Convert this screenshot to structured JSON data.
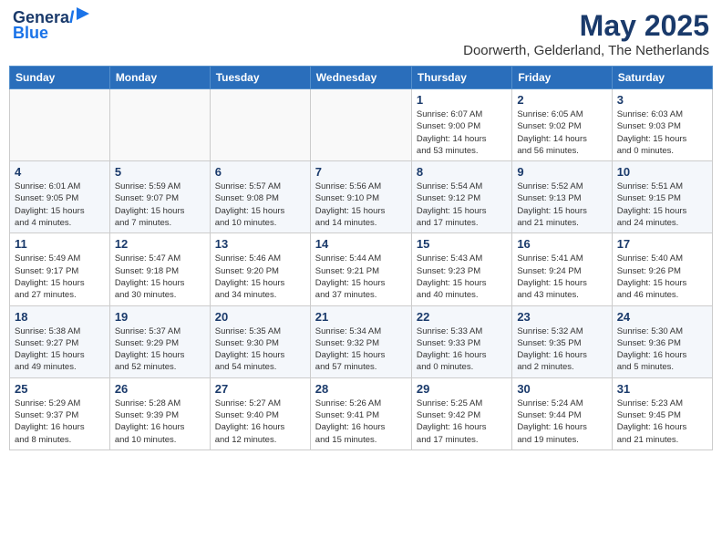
{
  "header": {
    "logo_line1": "General",
    "logo_line2": "Blue",
    "month_title": "May 2025",
    "location": "Doorwerth, Gelderland, The Netherlands"
  },
  "weekdays": [
    "Sunday",
    "Monday",
    "Tuesday",
    "Wednesday",
    "Thursday",
    "Friday",
    "Saturday"
  ],
  "weeks": [
    [
      {
        "day": "",
        "info": ""
      },
      {
        "day": "",
        "info": ""
      },
      {
        "day": "",
        "info": ""
      },
      {
        "day": "",
        "info": ""
      },
      {
        "day": "1",
        "info": "Sunrise: 6:07 AM\nSunset: 9:00 PM\nDaylight: 14 hours\nand 53 minutes."
      },
      {
        "day": "2",
        "info": "Sunrise: 6:05 AM\nSunset: 9:02 PM\nDaylight: 14 hours\nand 56 minutes."
      },
      {
        "day": "3",
        "info": "Sunrise: 6:03 AM\nSunset: 9:03 PM\nDaylight: 15 hours\nand 0 minutes."
      }
    ],
    [
      {
        "day": "4",
        "info": "Sunrise: 6:01 AM\nSunset: 9:05 PM\nDaylight: 15 hours\nand 4 minutes."
      },
      {
        "day": "5",
        "info": "Sunrise: 5:59 AM\nSunset: 9:07 PM\nDaylight: 15 hours\nand 7 minutes."
      },
      {
        "day": "6",
        "info": "Sunrise: 5:57 AM\nSunset: 9:08 PM\nDaylight: 15 hours\nand 10 minutes."
      },
      {
        "day": "7",
        "info": "Sunrise: 5:56 AM\nSunset: 9:10 PM\nDaylight: 15 hours\nand 14 minutes."
      },
      {
        "day": "8",
        "info": "Sunrise: 5:54 AM\nSunset: 9:12 PM\nDaylight: 15 hours\nand 17 minutes."
      },
      {
        "day": "9",
        "info": "Sunrise: 5:52 AM\nSunset: 9:13 PM\nDaylight: 15 hours\nand 21 minutes."
      },
      {
        "day": "10",
        "info": "Sunrise: 5:51 AM\nSunset: 9:15 PM\nDaylight: 15 hours\nand 24 minutes."
      }
    ],
    [
      {
        "day": "11",
        "info": "Sunrise: 5:49 AM\nSunset: 9:17 PM\nDaylight: 15 hours\nand 27 minutes."
      },
      {
        "day": "12",
        "info": "Sunrise: 5:47 AM\nSunset: 9:18 PM\nDaylight: 15 hours\nand 30 minutes."
      },
      {
        "day": "13",
        "info": "Sunrise: 5:46 AM\nSunset: 9:20 PM\nDaylight: 15 hours\nand 34 minutes."
      },
      {
        "day": "14",
        "info": "Sunrise: 5:44 AM\nSunset: 9:21 PM\nDaylight: 15 hours\nand 37 minutes."
      },
      {
        "day": "15",
        "info": "Sunrise: 5:43 AM\nSunset: 9:23 PM\nDaylight: 15 hours\nand 40 minutes."
      },
      {
        "day": "16",
        "info": "Sunrise: 5:41 AM\nSunset: 9:24 PM\nDaylight: 15 hours\nand 43 minutes."
      },
      {
        "day": "17",
        "info": "Sunrise: 5:40 AM\nSunset: 9:26 PM\nDaylight: 15 hours\nand 46 minutes."
      }
    ],
    [
      {
        "day": "18",
        "info": "Sunrise: 5:38 AM\nSunset: 9:27 PM\nDaylight: 15 hours\nand 49 minutes."
      },
      {
        "day": "19",
        "info": "Sunrise: 5:37 AM\nSunset: 9:29 PM\nDaylight: 15 hours\nand 52 minutes."
      },
      {
        "day": "20",
        "info": "Sunrise: 5:35 AM\nSunset: 9:30 PM\nDaylight: 15 hours\nand 54 minutes."
      },
      {
        "day": "21",
        "info": "Sunrise: 5:34 AM\nSunset: 9:32 PM\nDaylight: 15 hours\nand 57 minutes."
      },
      {
        "day": "22",
        "info": "Sunrise: 5:33 AM\nSunset: 9:33 PM\nDaylight: 16 hours\nand 0 minutes."
      },
      {
        "day": "23",
        "info": "Sunrise: 5:32 AM\nSunset: 9:35 PM\nDaylight: 16 hours\nand 2 minutes."
      },
      {
        "day": "24",
        "info": "Sunrise: 5:30 AM\nSunset: 9:36 PM\nDaylight: 16 hours\nand 5 minutes."
      }
    ],
    [
      {
        "day": "25",
        "info": "Sunrise: 5:29 AM\nSunset: 9:37 PM\nDaylight: 16 hours\nand 8 minutes."
      },
      {
        "day": "26",
        "info": "Sunrise: 5:28 AM\nSunset: 9:39 PM\nDaylight: 16 hours\nand 10 minutes."
      },
      {
        "day": "27",
        "info": "Sunrise: 5:27 AM\nSunset: 9:40 PM\nDaylight: 16 hours\nand 12 minutes."
      },
      {
        "day": "28",
        "info": "Sunrise: 5:26 AM\nSunset: 9:41 PM\nDaylight: 16 hours\nand 15 minutes."
      },
      {
        "day": "29",
        "info": "Sunrise: 5:25 AM\nSunset: 9:42 PM\nDaylight: 16 hours\nand 17 minutes."
      },
      {
        "day": "30",
        "info": "Sunrise: 5:24 AM\nSunset: 9:44 PM\nDaylight: 16 hours\nand 19 minutes."
      },
      {
        "day": "31",
        "info": "Sunrise: 5:23 AM\nSunset: 9:45 PM\nDaylight: 16 hours\nand 21 minutes."
      }
    ]
  ]
}
